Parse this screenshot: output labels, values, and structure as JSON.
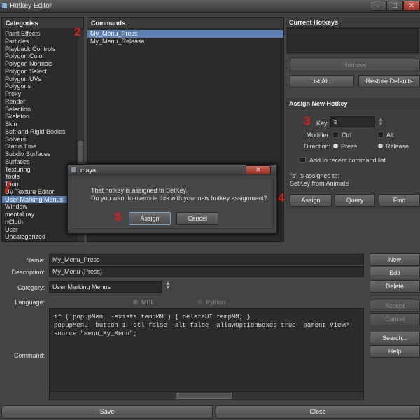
{
  "window": {
    "title": "Hotkey Editor"
  },
  "categories": {
    "header": "Categories",
    "items": [
      "Paint Effects",
      "Particles",
      "Playback Controls",
      "Polygon Color",
      "Polygon Normals",
      "Polygon Select",
      "Polygon UVs",
      "Polygons",
      "Proxy",
      "Render",
      "Selection",
      "Skeleton",
      "Skin",
      "Soft and Rigid Bodies",
      "Solvers",
      "Status Line",
      "Subdiv Surfaces",
      "Surfaces",
      "Texturing",
      "Tools",
      "Toon",
      "UV Texture Editor",
      "User Marking Menus",
      "Window",
      "mental ray",
      "nCloth",
      "User",
      "Uncategorized"
    ],
    "selected_index": 22
  },
  "commands": {
    "header": "Commands",
    "items": [
      "My_Menu_Press",
      "My_Menu_Release"
    ],
    "selected_index": 0
  },
  "current_hotkeys": {
    "header": "Current Hotkeys",
    "remove_label": "Remove",
    "list_all_label": "List All...",
    "restore_label": "Restore Defaults"
  },
  "assign": {
    "header": "Assign New Hotkey",
    "key_label": "Key:",
    "key_value": "s",
    "modifier_label": "Modifier:",
    "ctrl_label": "Ctrl",
    "alt_label": "Alt",
    "direction_label": "Direction:",
    "press_label": "Press",
    "release_label": "Release",
    "recent_label": "Add to recent command list",
    "info_line1": "\"s\" is assigned to:",
    "info_line2": "SetKey from Animate",
    "assign_label": "Assign",
    "query_label": "Query",
    "find_label": "Find"
  },
  "form": {
    "name_label": "Name:",
    "name_value": "My_Menu_Press",
    "description_label": "Description:",
    "description_value": "My_Menu (Press)",
    "category_label": "Category:",
    "category_value": "User Marking Menus",
    "language_label": "Language:",
    "mel_label": "MEL",
    "python_label": "Python",
    "command_label": "Command:",
    "code_lines": [
      "if (`popupMenu -exists tempMM`) { deleteUI tempMM; }",
      "popupMenu -button 1 -ctl false -alt false -allowOptionBoxes true -parent viewP",
      "source \"menu_My_Menu\";"
    ]
  },
  "side_buttons": {
    "new": "New",
    "edit": "Edit",
    "delete": "Delete",
    "accept": "Accept",
    "cancel": "Cancel",
    "search": "Search...",
    "help": "Help"
  },
  "bottom": {
    "save": "Save",
    "close": "Close"
  },
  "dialog": {
    "title": "maya",
    "message_line1": "That hotkey is assigned to SetKey.",
    "message_line2": "Do you want to override this with your new hotkey assignment?",
    "assign_label": "Assign",
    "cancel_label": "Cancel"
  },
  "markers": {
    "m2": "2",
    "m3": "3",
    "m4": "4",
    "m5": "5"
  },
  "colors": {
    "selection": "#5b7fb0",
    "annotation": "#e21c1c"
  },
  "icons": {
    "window_close": "close-icon",
    "dialog_close": "close-icon",
    "category_dropdown": "chevron-down-icon"
  }
}
